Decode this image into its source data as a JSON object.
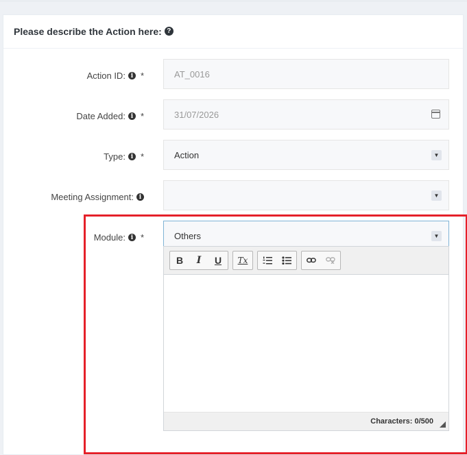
{
  "panel": {
    "title": "Please describe the Action here:"
  },
  "fields": {
    "action_id": {
      "label": "Action ID:",
      "value": "AT_0016",
      "required": "*"
    },
    "date_added": {
      "label": "Date Added:",
      "value": "31/07/2026",
      "required": "*"
    },
    "type": {
      "label": "Type:",
      "value": "Action",
      "required": "*"
    },
    "meeting_assignment": {
      "label": "Meeting Assignment:",
      "value": ""
    },
    "module": {
      "label": "Module:",
      "value": "Others",
      "required": "*"
    }
  },
  "editor": {
    "toolbar": {
      "bold": "B",
      "italic": "I",
      "underline": "U",
      "clear_format": "Tx"
    },
    "character_count": "Characters: 0/500"
  },
  "icons": [
    "question-circle-icon",
    "info-circle-icon",
    "calendar-icon",
    "dropdown-caret-icon",
    "numbered-list-icon",
    "bulleted-list-icon",
    "link-icon",
    "unlink-icon",
    "resize-handle-icon"
  ],
  "colors": {
    "highlight": "#e52029",
    "focus_border": "#7fb3d5"
  }
}
